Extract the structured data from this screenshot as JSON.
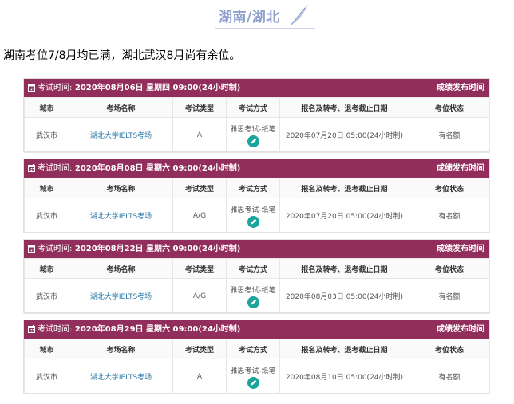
{
  "header": {
    "title": "湖南/湖北"
  },
  "intro": "湖南考位7/8月均已满，湖北武汉8月尚有余位。",
  "table_headers": [
    "城市",
    "考场名称",
    "考试类型",
    "考试方式",
    "报名及转考、退考截止日期",
    "考位状态"
  ],
  "bar_label": "考试时间:",
  "results_link": "成绩发布时间",
  "sessions": [
    {
      "date": "2020年08月06日 星期四 09:00(24小时制)",
      "city": "武汉市",
      "venue": "湖北大学IELTS考场",
      "type": "A",
      "mode": "雅思考试-纸笔",
      "deadline": "2020年07月20日 05:00(24小时制)",
      "status": "有名额"
    },
    {
      "date": "2020年08月08日 星期六 09:00(24小时制)",
      "city": "武汉市",
      "venue": "湖北大学IELTS考场",
      "type": "A/G",
      "mode": "雅思考试-纸笔",
      "deadline": "2020年07月20日 05:00(24小时制)",
      "status": "有名额"
    },
    {
      "date": "2020年08月22日 星期六 09:00(24小时制)",
      "city": "武汉市",
      "venue": "湖北大学IELTS考场",
      "type": "A/G",
      "mode": "雅思考试-纸笔",
      "deadline": "2020年08月03日 05:00(24小时制)",
      "status": "有名额"
    },
    {
      "date": "2020年08月29日 星期六 09:00(24小时制)",
      "city": "武汉市",
      "venue": "湖北大学IELTS考场",
      "type": "A",
      "mode": "雅思考试-纸笔",
      "deadline": "2020年08月10日 05:00(24小时制)",
      "status": "有名额"
    }
  ],
  "colors": {
    "bar": "#912e5b",
    "edit_icon": "#1ba39c",
    "venue_link": "#2e7aa8",
    "header_title": "#8ea0cc"
  }
}
